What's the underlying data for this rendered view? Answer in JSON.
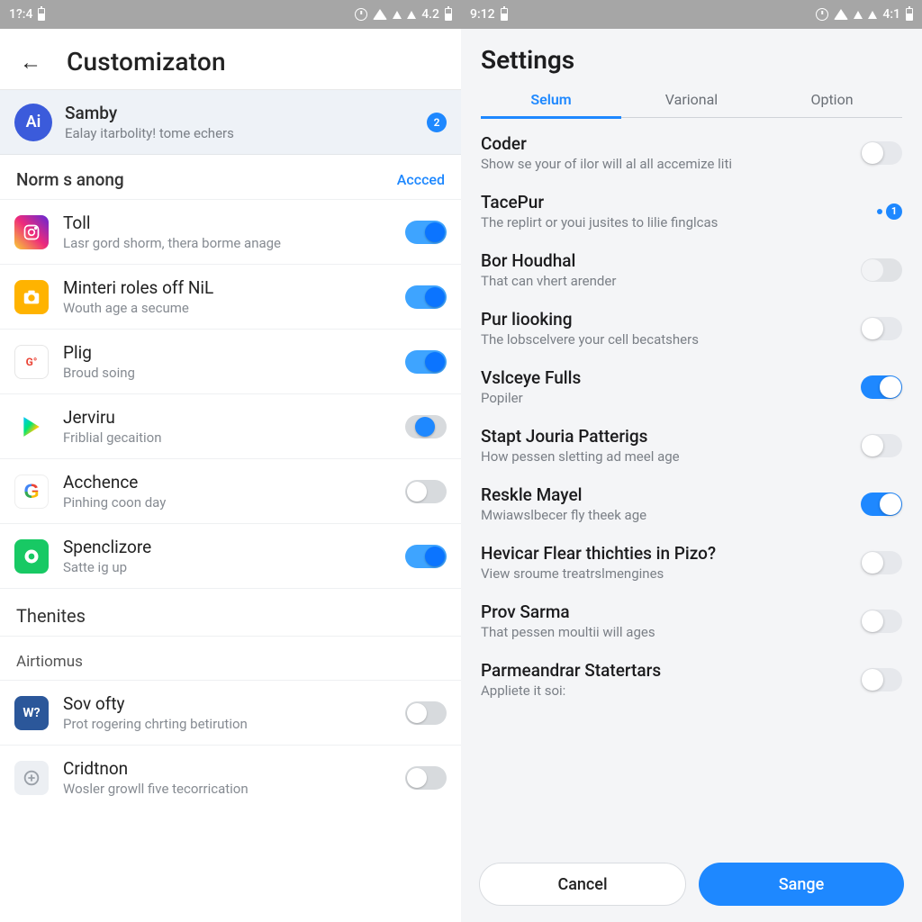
{
  "left": {
    "status": {
      "time": "1?:4",
      "net": "4.2"
    },
    "header": {
      "title": "Customizaton"
    },
    "hero": {
      "avatar_initials": "Ai",
      "title": "Samby",
      "subtitle": "Ealay itarbolity! tome echers",
      "badge": "2"
    },
    "section": {
      "name": "Norm s anong",
      "link": "Accced"
    },
    "apps": [
      {
        "icon": "instagram",
        "title": "Toll",
        "sub": "Lasr gord shorm, thera borme anage",
        "state": "on"
      },
      {
        "icon": "camera",
        "title": "Minteri roles off NiL",
        "sub": "Wouth age a secume",
        "state": "on"
      },
      {
        "icon": "plig",
        "title": "Plig",
        "sub": "Broud soing",
        "state": "on"
      },
      {
        "icon": "play",
        "title": "Jerviru",
        "sub": "Friblial gecaition",
        "state": "mid"
      },
      {
        "icon": "google",
        "title": "Acchence",
        "sub": "Pinhing coon day",
        "state": "off"
      },
      {
        "icon": "spen",
        "title": "Spenclizore",
        "sub": "Satte ig up",
        "state": "on"
      }
    ],
    "section2": "Thenites",
    "section3": "Airtiomus",
    "apps2": [
      {
        "icon": "word",
        "title": "Sov ofty",
        "sub": "Prot rogering chrting betirution",
        "state": "off"
      },
      {
        "icon": "crid",
        "title": "Cridtnon",
        "sub": "Wosler growll five tecorrication",
        "state": "off"
      }
    ]
  },
  "right": {
    "status": {
      "time": "9:12",
      "net": "4:1"
    },
    "header": {
      "title": "Settings"
    },
    "tabs": [
      "Selum",
      "Varional",
      "Option"
    ],
    "active_tab": 0,
    "rows": [
      {
        "title": "Coder",
        "sub": "Show se your of ilor will al all accemize liti",
        "ctrl": "toggle",
        "state": "off"
      },
      {
        "title": "TacePur",
        "sub": "The replirt or youi jusites to lilie finglcas",
        "ctrl": "badge",
        "badge": "1"
      },
      {
        "title": "Bor Houdhal",
        "sub": "That can vhert arender",
        "ctrl": "toggle",
        "state": "dis"
      },
      {
        "title": "Pur liooking",
        "sub": "The lobscelvere your cell becatshers",
        "ctrl": "toggle",
        "state": "off"
      },
      {
        "title": "Vslceye Fulls",
        "sub": "Popiler",
        "ctrl": "toggle",
        "state": "on"
      },
      {
        "title": "Stapt Jouria Patterigs",
        "sub": "How pessen sletting ad meel age",
        "ctrl": "toggle",
        "state": "off"
      },
      {
        "title": "Reskle Mayel",
        "sub": "Mwiawslbecer fly theek age",
        "ctrl": "toggle",
        "state": "on"
      },
      {
        "title": "Hevicar Flear thichties in Pizo?",
        "sub": "View sroume treatrslmengines",
        "ctrl": "toggle",
        "state": "off"
      },
      {
        "title": "Prov Sarma",
        "sub": "That pessen moultii will ages",
        "ctrl": "toggle",
        "state": "off"
      },
      {
        "title": "Parmeandrar Statertars",
        "sub": "Appliete it soi:",
        "ctrl": "toggle",
        "state": "off"
      }
    ],
    "footer": {
      "cancel": "Cancel",
      "save": "Sange"
    }
  }
}
